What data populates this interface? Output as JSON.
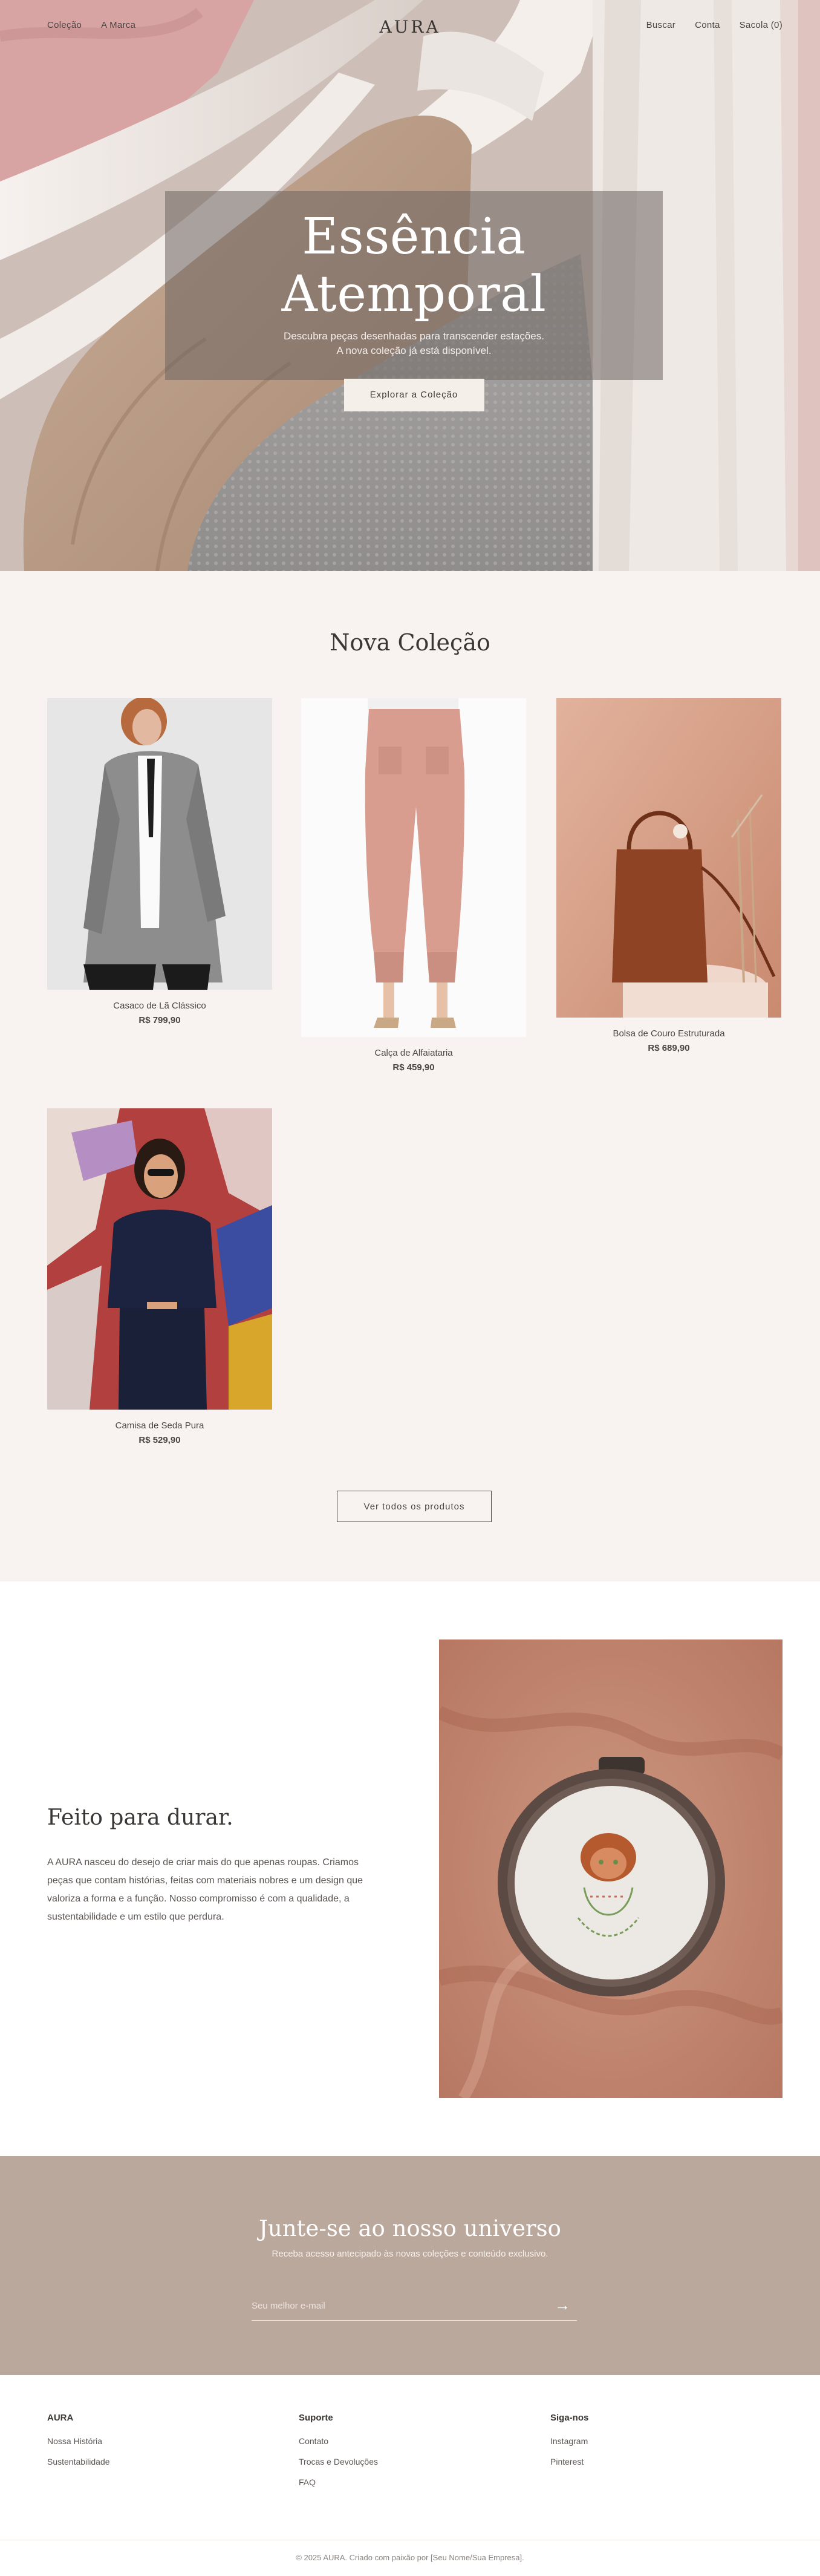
{
  "nav": {
    "left": [
      "Coleção",
      "A Marca"
    ],
    "logo": "AURA",
    "right": [
      "Buscar",
      "Conta",
      "Sacola (0)"
    ]
  },
  "hero": {
    "title": "Essência Atemporal",
    "subtitle": "Descubra peças desenhadas para transcender estações. A nova coleção já está disponível.",
    "button": "Explorar a Coleção"
  },
  "collection": {
    "title": "Nova Coleção",
    "products": [
      {
        "name": "Casaco de Lã Clássico",
        "price": "R$ 799,90"
      },
      {
        "name": "Calça de Alfaiataria",
        "price": "R$ 459,90"
      },
      {
        "name": "Bolsa de Couro Estruturada",
        "price": "R$ 689,90"
      },
      {
        "name": "Camisa de Seda Pura",
        "price": "R$ 529,90"
      }
    ],
    "button": "Ver todos os produtos"
  },
  "about": {
    "title": "Feito para durar.",
    "text": "A AURA nasceu do desejo de criar mais do que apenas roupas. Criamos peças que contam histórias, feitas com materiais nobres e um design que valoriza a forma e a função. Nosso compromisso é com a qualidade, a sustentabilidade e um estilo que perdura."
  },
  "newsletter": {
    "title": "Junte-se ao nosso universo",
    "subtitle": "Receba acesso antecipado às novas coleções e conteúdo exclusivo.",
    "placeholder": "Seu melhor e-mail",
    "submit_icon": "arrow-right-icon",
    "submit_glyph": "→"
  },
  "footer": {
    "columns": [
      {
        "title": "AURA",
        "links": [
          "Nossa História",
          "Sustentabilidade"
        ]
      },
      {
        "title": "Suporte",
        "links": [
          "Contato",
          "Trocas e Devoluções",
          "FAQ"
        ]
      },
      {
        "title": "Siga-nos",
        "links": [
          "Instagram",
          "Pinterest"
        ]
      }
    ],
    "copyright": "© 2025 AURA. Criado com paixão por [Seu Nome/Sua Empresa]."
  }
}
